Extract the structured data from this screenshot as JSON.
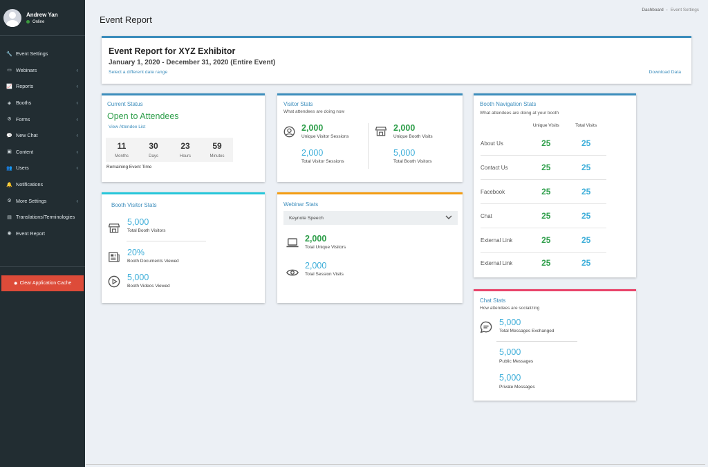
{
  "user": {
    "name": "Andrew Yan",
    "status": "Online"
  },
  "menu": [
    {
      "label": "Event Settings",
      "icon": "wrench-icon",
      "chevron": false
    },
    {
      "label": "Webinars",
      "icon": "monitor-icon",
      "chevron": true
    },
    {
      "label": "Reports",
      "icon": "chart-icon",
      "chevron": true
    },
    {
      "label": "Booths",
      "icon": "cube-icon",
      "chevron": true
    },
    {
      "label": "Forms",
      "icon": "gear-icon",
      "chevron": true
    },
    {
      "label": "New Chat",
      "icon": "chat-icon",
      "chevron": true
    },
    {
      "label": "Content",
      "icon": "image-icon",
      "chevron": true
    },
    {
      "label": "Users",
      "icon": "users-icon",
      "chevron": true
    },
    {
      "label": "Notifications",
      "icon": "bell-icon",
      "chevron": false
    },
    {
      "label": "More Settings",
      "icon": "gear-icon",
      "chevron": true
    },
    {
      "label": "Translations/Terminologies",
      "icon": "document-icon",
      "chevron": false
    },
    {
      "label": "Event Report",
      "icon": "report-icon",
      "chevron": false
    }
  ],
  "cache_button": "Clear Application Cache",
  "header": {
    "title": "Event Report"
  },
  "breadcrumb": {
    "items": [
      "Dashboard",
      "Event Settings"
    ]
  },
  "report": {
    "title": "Event Report for XYZ Exhibitor",
    "dates": "January 1, 2020 - December 31, 2020 (Entire Event)",
    "change_range": "Select a different date range",
    "download": "Download Data"
  },
  "current_status": {
    "title": "Current Status",
    "status": "Open to Attendees",
    "link": "View Attendee List",
    "timer": [
      {
        "value": "11",
        "unit": "Months"
      },
      {
        "value": "30",
        "unit": "Days"
      },
      {
        "value": "23",
        "unit": "Hours"
      },
      {
        "value": "59",
        "unit": "Minutes"
      }
    ],
    "timer_caption": "Remaining Event Time"
  },
  "visitor_stats": {
    "title": "Visitor Stats",
    "subtitle": "What attendees are doing now",
    "unique_sessions": {
      "value": "2,000",
      "label": "Unique Visitor Sessions"
    },
    "total_sessions": {
      "value": "2,000",
      "label": "Total Visitor Sessions"
    },
    "unique_booth": {
      "value": "2,000",
      "label": "Unique Booth Visits"
    },
    "total_booth": {
      "value": "5,000",
      "label": "Total Booth Visitors"
    }
  },
  "booth_nav": {
    "title": "Booth Navigation Stats",
    "subtitle": "What attendees are doing at your booth",
    "col_unique": "Unique Visits",
    "col_total": "Total Visits",
    "rows": [
      {
        "label": "About Us",
        "unique": "25",
        "total": "25"
      },
      {
        "label": "Contact Us",
        "unique": "25",
        "total": "25"
      },
      {
        "label": "Facebook",
        "unique": "25",
        "total": "25"
      },
      {
        "label": "Chat",
        "unique": "25",
        "total": "25"
      },
      {
        "label": "External Link",
        "unique": "25",
        "total": "25"
      },
      {
        "label": "External Link",
        "unique": "25",
        "total": "25"
      }
    ]
  },
  "booth_visitor": {
    "title": "Booth Visitor Stats",
    "visitors": {
      "value": "5,000",
      "label": "Total Booth Visitors"
    },
    "docs": {
      "value": "20%",
      "label": "Booth Documents Viewed"
    },
    "videos": {
      "value": "5,000",
      "label": "Booth Videos Viewed"
    }
  },
  "webinar": {
    "title": "Webinar Stats",
    "selected": "Keynote Speech",
    "unique": {
      "value": "2,000",
      "label": "Total Unique Visitors"
    },
    "sessions": {
      "value": "2,000",
      "label": "Total Session Visits"
    }
  },
  "chat": {
    "title": "Chat Stats",
    "subtitle": "How attendees are socializing",
    "total": {
      "value": "5,000",
      "label": "Total Messages Exchanged"
    },
    "public": {
      "value": "5,000",
      "label": "Public Messages"
    },
    "private": {
      "value": "5,000",
      "label": "Private Messages"
    }
  }
}
